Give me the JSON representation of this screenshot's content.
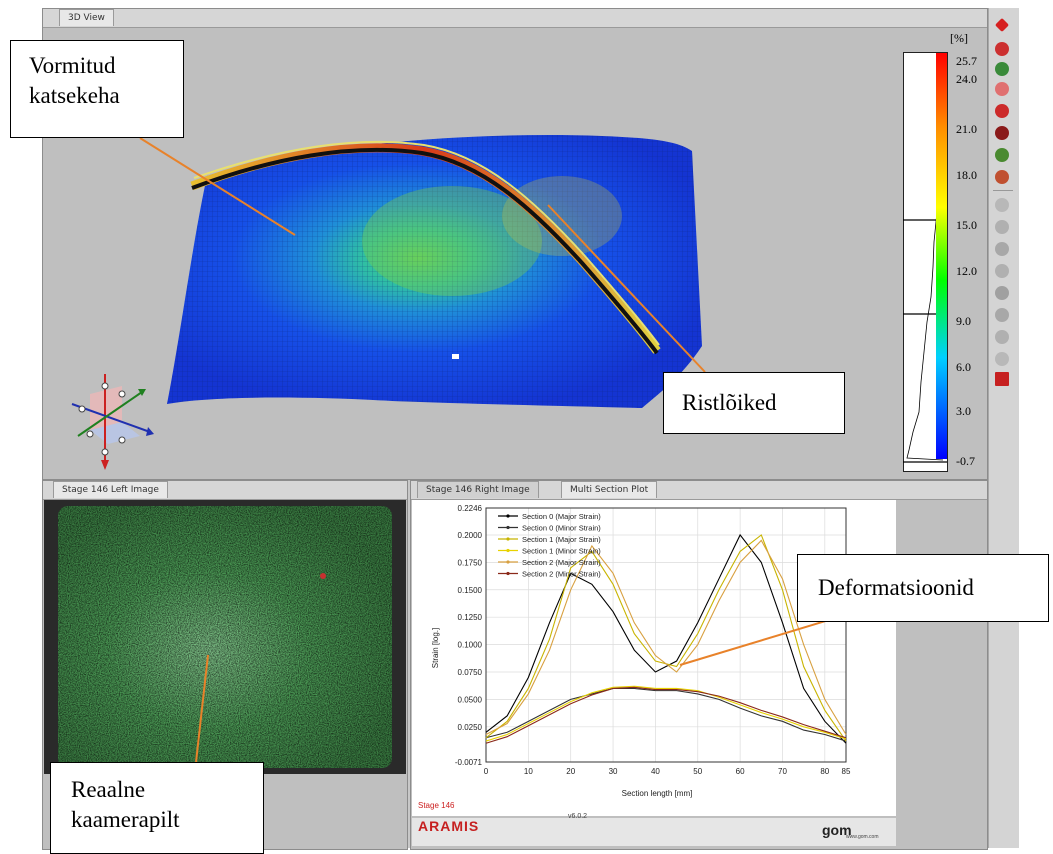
{
  "window": {
    "tabs_top": [
      "3D View"
    ],
    "tab_left_image": "Stage 146 Left Image",
    "tab_right_image": "Stage 146 Right Image",
    "tab_multi_section": "Multi Section Plot"
  },
  "callouts": {
    "specimen_line1": "Vormitud",
    "specimen_line2": "katsekeha",
    "sections": "Ristlõiked",
    "deformations": "Deformatsioonid",
    "camera_line1": "Reaalne",
    "camera_line2": "kaamerapilt"
  },
  "colorbar": {
    "unit": "[%]",
    "ticks": [
      "25.7",
      "24.0",
      "21.0",
      "18.0",
      "15.0",
      "12.0",
      "9.0",
      "6.0",
      "3.0",
      "-0.7"
    ],
    "colors": [
      "#ff0000",
      "#ff8c00",
      "#ffff00",
      "#00ff00",
      "#00d0ff",
      "#0000ff"
    ]
  },
  "plot": {
    "stage_label": "Stage 146",
    "brand_left": "ARAMIS",
    "brand_center": "v6.0.2",
    "brand_right": "gom",
    "brand_right_small": "www.gom.com"
  },
  "chart_data": {
    "type": "line",
    "xlabel": "Section length [mm]",
    "ylabel": "Strain [log.]",
    "xlim": [
      0,
      85
    ],
    "ylim": [
      -0.0071,
      0.2246
    ],
    "x_ticks": [
      "0",
      "10",
      "20",
      "30",
      "40",
      "50",
      "60",
      "70",
      "80",
      "85"
    ],
    "y_ticks": [
      "0.2246",
      "0.2000",
      "0.1750",
      "0.1500",
      "0.1250",
      "0.1000",
      "0.0750",
      "0.0500",
      "0.0250",
      "-0.0071"
    ],
    "x": [
      0,
      5,
      10,
      15,
      20,
      25,
      30,
      35,
      40,
      45,
      50,
      55,
      60,
      65,
      70,
      75,
      80,
      85
    ],
    "series": [
      {
        "name": "Section 0 (Major Strain)",
        "color": "#000000",
        "values": [
          0.02,
          0.035,
          0.07,
          0.12,
          0.165,
          0.155,
          0.13,
          0.095,
          0.075,
          0.085,
          0.12,
          0.16,
          0.2,
          0.175,
          0.12,
          0.06,
          0.03,
          0.01
        ]
      },
      {
        "name": "Section 0 (Minor Strain)",
        "color": "#333333",
        "values": [
          0.015,
          0.02,
          0.03,
          0.04,
          0.05,
          0.055,
          0.06,
          0.06,
          0.058,
          0.058,
          0.055,
          0.05,
          0.042,
          0.035,
          0.03,
          0.022,
          0.018,
          0.012
        ]
      },
      {
        "name": "Section 1 (Major Strain)",
        "color": "#c8b400",
        "values": [
          0.015,
          0.03,
          0.06,
          0.105,
          0.17,
          0.185,
          0.155,
          0.11,
          0.085,
          0.08,
          0.11,
          0.15,
          0.185,
          0.2,
          0.15,
          0.08,
          0.04,
          0.012
        ]
      },
      {
        "name": "Section 1 (Minor Strain)",
        "color": "#e8d200",
        "values": [
          0.012,
          0.018,
          0.028,
          0.038,
          0.048,
          0.056,
          0.061,
          0.062,
          0.06,
          0.06,
          0.058,
          0.052,
          0.045,
          0.038,
          0.032,
          0.025,
          0.02,
          0.014
        ]
      },
      {
        "name": "Section 2 (Major Strain)",
        "color": "#d8a040",
        "values": [
          0.018,
          0.028,
          0.055,
          0.095,
          0.15,
          0.19,
          0.165,
          0.12,
          0.09,
          0.075,
          0.1,
          0.14,
          0.175,
          0.195,
          0.16,
          0.1,
          0.05,
          0.018
        ]
      },
      {
        "name": "Section 2 (Minor Strain)",
        "color": "#8b2a1a",
        "values": [
          0.01,
          0.016,
          0.026,
          0.036,
          0.046,
          0.054,
          0.06,
          0.061,
          0.059,
          0.059,
          0.057,
          0.053,
          0.047,
          0.04,
          0.034,
          0.027,
          0.021,
          0.015
        ]
      }
    ],
    "grid": true,
    "legend_position": "top-left"
  }
}
